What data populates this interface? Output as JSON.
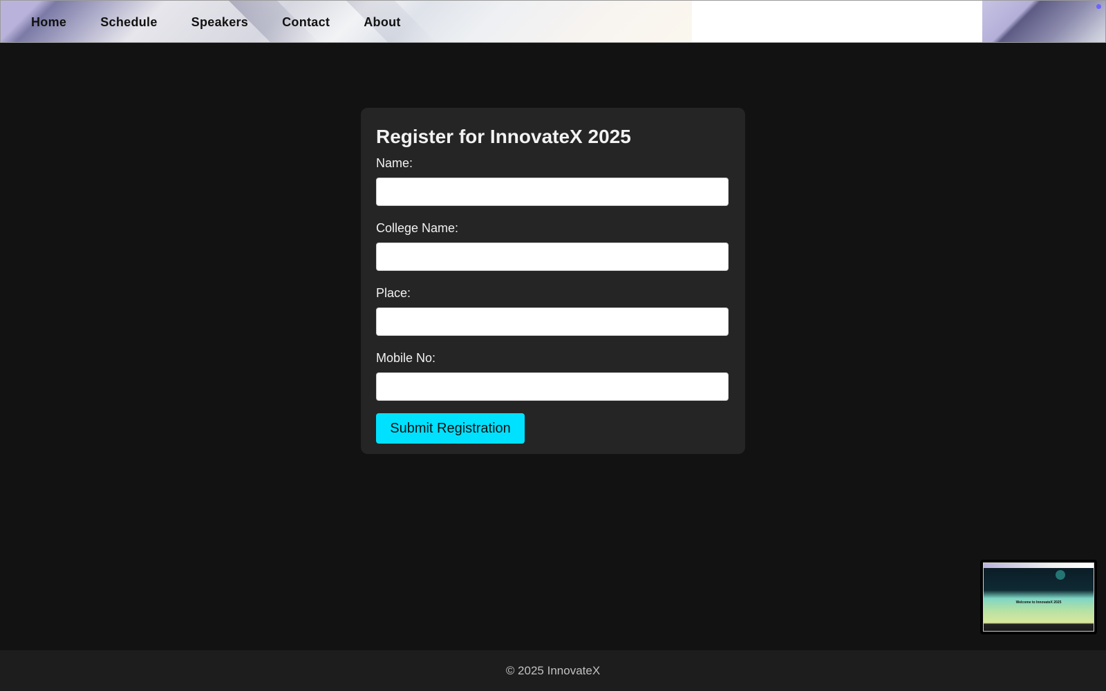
{
  "nav": {
    "items": [
      {
        "label": "Home"
      },
      {
        "label": "Schedule"
      },
      {
        "label": "Speakers"
      },
      {
        "label": "Contact"
      },
      {
        "label": "About"
      }
    ]
  },
  "form": {
    "title": "Register for InnovateX 2025",
    "fields": [
      {
        "label": "Name:",
        "value": "",
        "placeholder": ""
      },
      {
        "label": "College Name:",
        "value": "",
        "placeholder": ""
      },
      {
        "label": "Place:",
        "value": "",
        "placeholder": ""
      },
      {
        "label": "Mobile No:",
        "value": "",
        "placeholder": ""
      }
    ],
    "submit_label": "Submit Registration"
  },
  "thumbnail": {
    "title": "Welcome to InnovateX 2025"
  },
  "footer": {
    "text": "© 2025 InnovateX"
  },
  "colors": {
    "background": "#121212",
    "card": "#252525",
    "accent": "#00e1ff",
    "footer": "#1d1d1d"
  }
}
